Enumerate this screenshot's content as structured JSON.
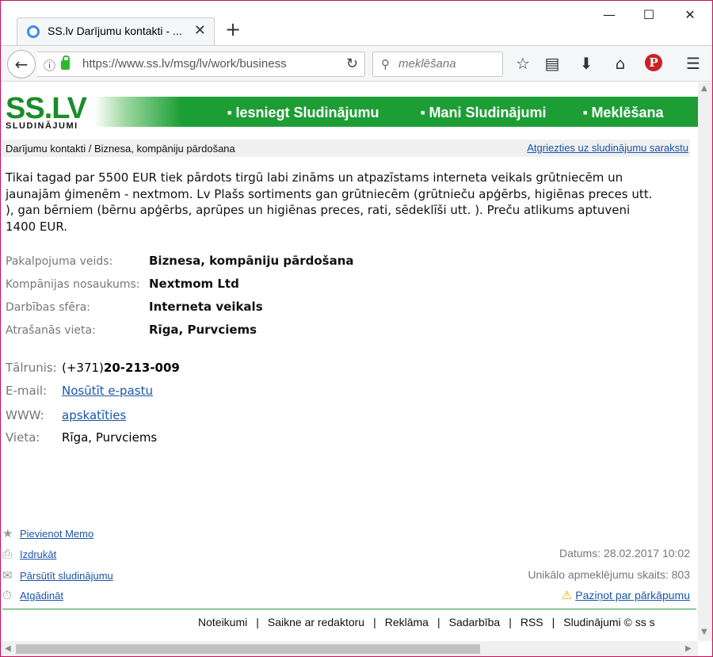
{
  "browser": {
    "tab_title": "SS.lv Darījumu kontakti - ...",
    "url": "https://www.ss.lv/msg/lv/work/business",
    "search_placeholder": "meklēšana"
  },
  "site": {
    "logo_main": "SS.LV",
    "logo_sub": "SLUDINĀJUMI",
    "menu": [
      "Iesniegt Sludinājumu",
      "Mani Sludinājumi",
      "Meklēšana"
    ]
  },
  "breadcrumb": "Darījumu kontakti / Biznesa, kompāniju pārdošana",
  "back_link": "Atgriezties uz sludinājumu sarakstu",
  "description": "Tikai tagad par 5500 EUR tiek pārdots tirgū labi zināms un atpazīstams interneta veikals grūtniecēm un jaunajām ģimenēm - nextmom. Lv Plašs sortiments gan grūtniecēm (grūtnieču apģērbs, higiēnas preces utt. ), gan bērniem (bērnu apģērbs, aprūpes un higiēnas preces, rati, sēdeklīši utt. ). Preču atlikums aptuveni 1400 EUR.",
  "options": [
    {
      "label": "Pakalpojuma veids:",
      "value": "Biznesa, kompāniju pārdošana"
    },
    {
      "label": "Kompānijas nosaukums:",
      "value": "Nextmom Ltd"
    },
    {
      "label": "Darbības sfēra:",
      "value": "Interneta veikals"
    },
    {
      "label": "Atrašanās vieta:",
      "value": "Rīga, Purvciems"
    }
  ],
  "contacts": {
    "phone_label": "Tālrunis:",
    "phone_prefix": "(+371)",
    "phone_number": "20-213-009",
    "email_label": "E-mail:",
    "email_link": "Nosūtīt e-pastu",
    "www_label": "WWW:",
    "www_link": "apskatīties",
    "place_label": "Vieta:",
    "place_value": "Rīga, Purvciems"
  },
  "actions": {
    "memo": "Pievienot Memo",
    "print": "Izdrukāt",
    "forward": "Pārsūtīt sludinājumu",
    "remind": "Atgādināt"
  },
  "meta": {
    "date": "Datums: 28.02.2017 10:02",
    "visits": "Unikālo apmeklējumu skaits: 803",
    "report": "Paziņot par pārkāpumu"
  },
  "footer_links": [
    "Noteikumi",
    "Saikne ar redaktoru",
    "Reklāma",
    "Sadarbība",
    "RSS",
    "Sludinājumi © ss s"
  ],
  "colors": {
    "brand_green": "#1c9e35",
    "link_blue": "#1a55a9"
  },
  "icons": [
    "star-icon",
    "print-icon",
    "mail-icon",
    "timer-icon",
    "warning-icon"
  ]
}
